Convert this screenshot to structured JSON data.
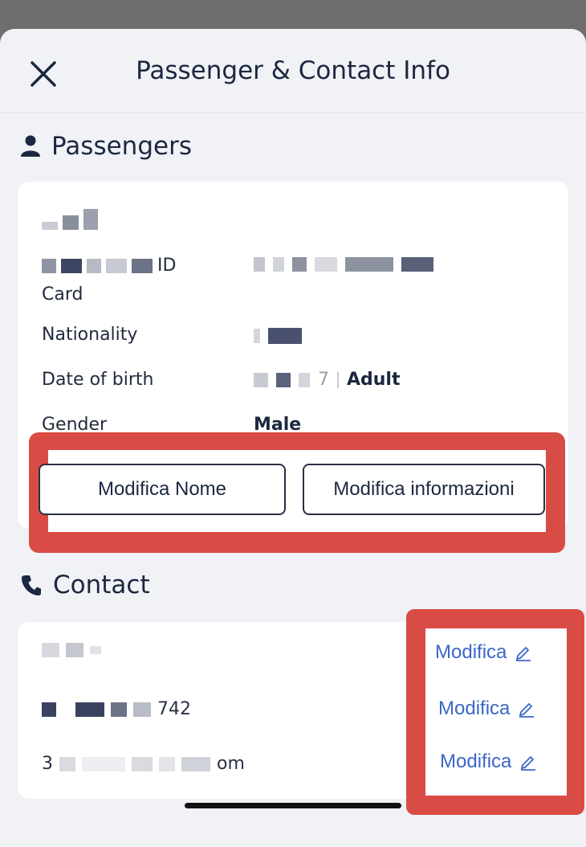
{
  "header": {
    "title": "Passenger & Contact Info"
  },
  "passengers": {
    "section_title": "Passengers",
    "id_label_suffix": "ID",
    "id_label_line2": "Card",
    "nationality_label": "Nationality",
    "dob_label": "Date of birth",
    "dob_suffix": "7",
    "age_type": "Adult",
    "gender_label": "Gender",
    "gender_value": "Male",
    "edit_name_button": "Modifica Nome",
    "edit_info_button": "Modifica informazioni"
  },
  "contact": {
    "section_title": "Contact",
    "phone_suffix": "742",
    "email_prefix": "3",
    "email_suffix": "om",
    "edit_label": "Modifica"
  },
  "colors": {
    "highlight_red": "#d94c45",
    "link_blue": "#3b67c8",
    "text_dark": "#1c2740"
  }
}
